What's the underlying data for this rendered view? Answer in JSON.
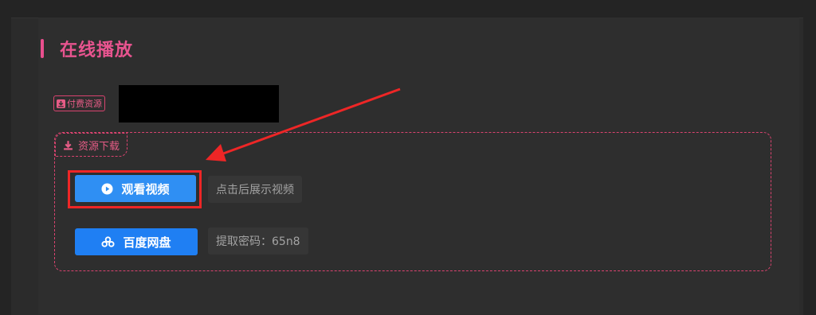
{
  "section": {
    "title": "在线播放"
  },
  "paid": {
    "label": "付费资源"
  },
  "download": {
    "label": "资源下载"
  },
  "buttons": {
    "watch": {
      "label": "观看视频",
      "hint": "点击后展示视频"
    },
    "baidu": {
      "label": "百度网盘",
      "hint": "提取密码：65n8"
    }
  },
  "colors": {
    "accent": "#e8548f",
    "button_blue": "#2f8ff3",
    "annotation_red": "#ee2626"
  },
  "icons": {
    "download": "download-icon",
    "play": "play-icon",
    "baidu": "baidu-cloud-icon"
  }
}
